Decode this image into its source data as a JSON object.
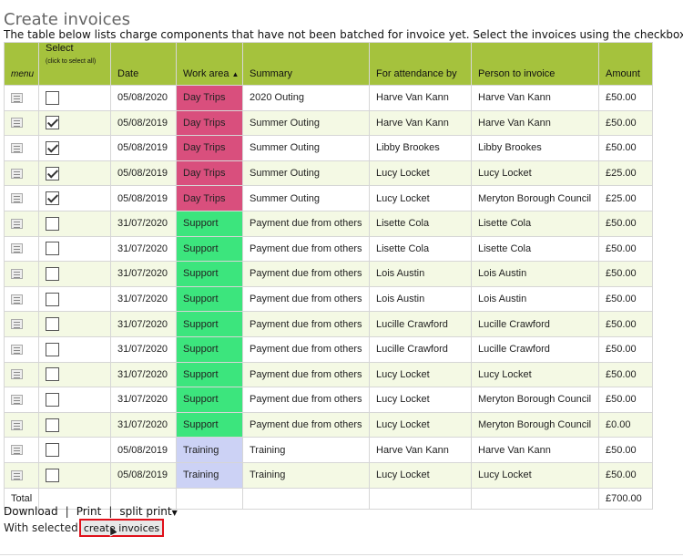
{
  "page": {
    "title": "Create invoices",
    "intro": "The table below lists charge components that have not been batched for invoice yet. Select the invoices using the checkboxes and click"
  },
  "table": {
    "headers": {
      "menu": "menu",
      "select": "Select",
      "select_sub": "(click to select all)",
      "date": "Date",
      "work_area": "Work area",
      "summary": "Summary",
      "attendance": "For attendance by",
      "person": "Person to invoice",
      "amount": "Amount"
    },
    "rows": [
      {
        "checked": false,
        "date": "05/08/2020",
        "work_area": "Day Trips",
        "summary": "2020 Outing",
        "attendance": "Harve Van Kann",
        "person": "Harve Van Kann",
        "amount": "£50.00"
      },
      {
        "checked": true,
        "date": "05/08/2019",
        "work_area": "Day Trips",
        "summary": "Summer Outing",
        "attendance": "Harve Van Kann",
        "person": "Harve Van Kann",
        "amount": "£50.00"
      },
      {
        "checked": true,
        "date": "05/08/2019",
        "work_area": "Day Trips",
        "summary": "Summer Outing",
        "attendance": "Libby Brookes",
        "person": "Libby Brookes",
        "amount": "£50.00"
      },
      {
        "checked": true,
        "date": "05/08/2019",
        "work_area": "Day Trips",
        "summary": "Summer Outing",
        "attendance": "Lucy Locket",
        "person": "Lucy Locket",
        "amount": "£25.00"
      },
      {
        "checked": true,
        "date": "05/08/2019",
        "work_area": "Day Trips",
        "summary": "Summer Outing",
        "attendance": "Lucy Locket",
        "person": "Meryton Borough Council",
        "amount": "£25.00"
      },
      {
        "checked": false,
        "date": "31/07/2020",
        "work_area": "Support",
        "summary": "Payment due from others",
        "attendance": "Lisette Cola",
        "person": "Lisette Cola",
        "amount": "£50.00"
      },
      {
        "checked": false,
        "date": "31/07/2020",
        "work_area": "Support",
        "summary": "Payment due from others",
        "attendance": "Lisette Cola",
        "person": "Lisette Cola",
        "amount": "£50.00"
      },
      {
        "checked": false,
        "date": "31/07/2020",
        "work_area": "Support",
        "summary": "Payment due from others",
        "attendance": "Lois Austin",
        "person": "Lois Austin",
        "amount": "£50.00"
      },
      {
        "checked": false,
        "date": "31/07/2020",
        "work_area": "Support",
        "summary": "Payment due from others",
        "attendance": "Lois Austin",
        "person": "Lois Austin",
        "amount": "£50.00"
      },
      {
        "checked": false,
        "date": "31/07/2020",
        "work_area": "Support",
        "summary": "Payment due from others",
        "attendance": "Lucille Crawford",
        "person": "Lucille Crawford",
        "amount": "£50.00"
      },
      {
        "checked": false,
        "date": "31/07/2020",
        "work_area": "Support",
        "summary": "Payment due from others",
        "attendance": "Lucille Crawford",
        "person": "Lucille Crawford",
        "amount": "£50.00"
      },
      {
        "checked": false,
        "date": "31/07/2020",
        "work_area": "Support",
        "summary": "Payment due from others",
        "attendance": "Lucy Locket",
        "person": "Lucy Locket",
        "amount": "£50.00"
      },
      {
        "checked": false,
        "date": "31/07/2020",
        "work_area": "Support",
        "summary": "Payment due from others",
        "attendance": "Lucy Locket",
        "person": "Meryton Borough Council",
        "amount": "£50.00"
      },
      {
        "checked": false,
        "date": "31/07/2020",
        "work_area": "Support",
        "summary": "Payment due from others",
        "attendance": "Lucy Locket",
        "person": "Meryton Borough Council",
        "amount": "£0.00"
      },
      {
        "checked": false,
        "date": "05/08/2019",
        "work_area": "Training",
        "summary": "Training",
        "attendance": "Harve Van Kann",
        "person": "Harve Van Kann",
        "amount": "£50.00"
      },
      {
        "checked": false,
        "date": "05/08/2019",
        "work_area": "Training",
        "summary": "Training",
        "attendance": "Lucy Locket",
        "person": "Lucy Locket",
        "amount": "£50.00"
      }
    ],
    "total_label": "Total",
    "total_amount": "£700.00"
  },
  "work_area_colors": {
    "Day Trips": "#d94f7d",
    "Support": "#3ce57d",
    "Training": "#ccd2f5"
  },
  "header_color": "#a5c23d",
  "actions": {
    "download": "Download",
    "print": "Print",
    "split_print": "split print",
    "with_selected": "With selected:",
    "create_invoices": "create invoices"
  }
}
